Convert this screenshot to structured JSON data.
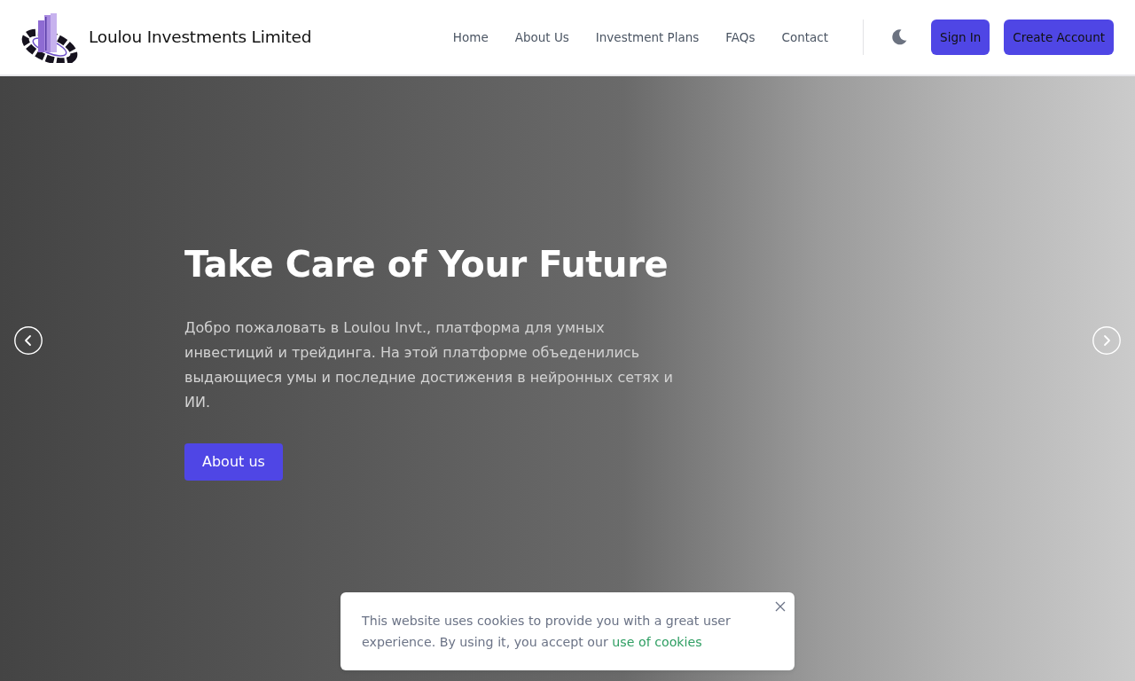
{
  "header": {
    "brand": {
      "name": "Loulou Investments Limited"
    },
    "nav_links": [
      {
        "label": "Home"
      },
      {
        "label": "About Us"
      },
      {
        "label": "Investment Plans"
      },
      {
        "label": "FAQs"
      },
      {
        "label": "Contact"
      }
    ],
    "buttons": [
      {
        "label": "Sign In"
      },
      {
        "label": "Create Account"
      }
    ]
  },
  "hero": {
    "title": "Take Care of Your Future",
    "text": "Добро пожаловать в Loulou Invt., платформа для умных инвестиций и трейдинга. На этой платформе объеденились выдающиеся умы и последние достижения в нейронных сетях и ИИ.",
    "button": "About us"
  },
  "cookie_notice": {
    "text": "This website uses cookies to provide you with a great user experience. By using it, you accept our",
    "link": "use of cookies"
  }
}
